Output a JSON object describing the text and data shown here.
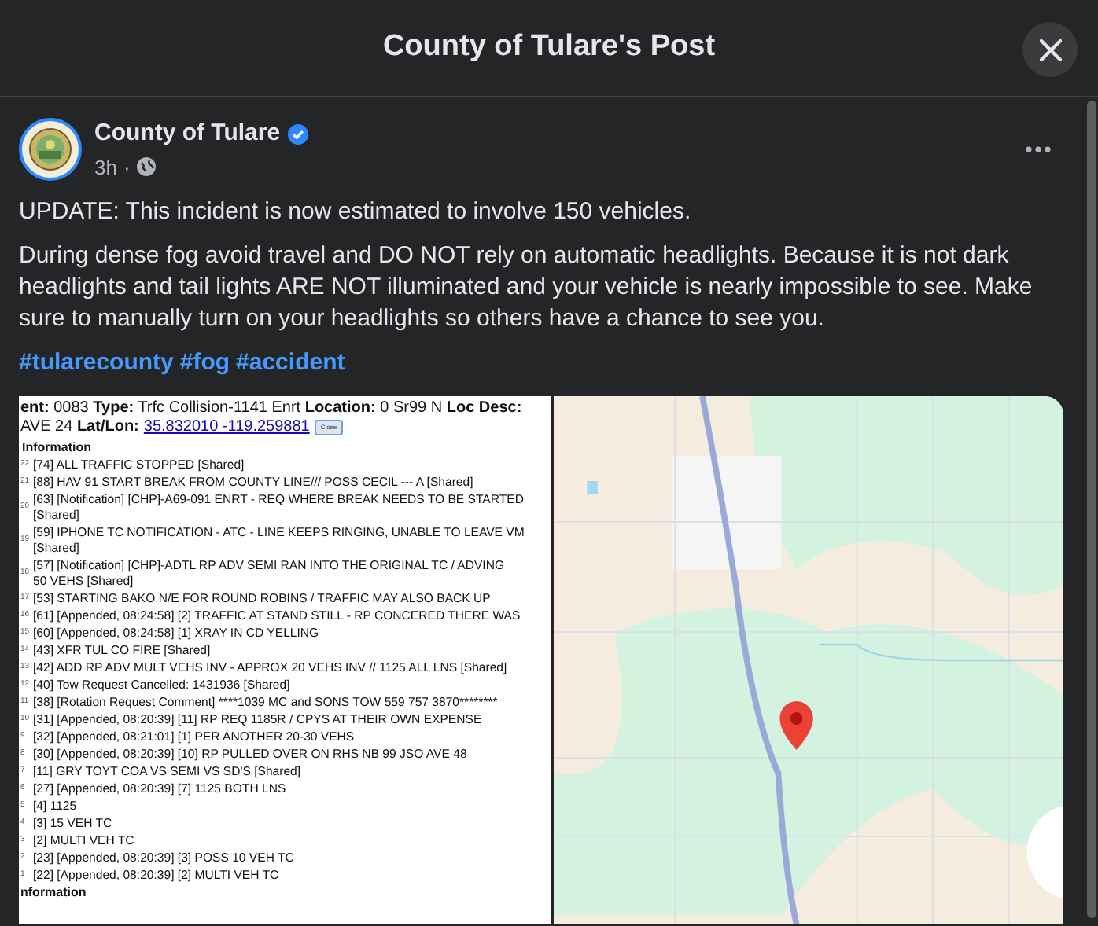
{
  "dialog": {
    "title": "County of Tulare's Post"
  },
  "post": {
    "author": "County of Tulare",
    "time": "3h",
    "separator": "·",
    "paragraphs": [
      "UPDATE: This incident is now estimated to involve 150 vehicles.",
      "During dense fog avoid travel and DO NOT rely on automatic headlights. Because it is not dark headlights and tail lights ARE NOT illuminated and your vehicle is nearly impossible to see. Make sure to manually turn on your headlights so others have a chance to see you."
    ],
    "hashtags": [
      "#tularecounty",
      "#fog",
      "#accident"
    ],
    "document": {
      "line_1": "**ent:** 0083 **Type:** Trfc Collision-1141 Enrt **Location:** 0 Sr99 N **Loc Desc:**",
      "line_2": "AVE 24 **Lat/Lon:**",
      "coordinates": "35.832010 -119.259881",
      "close_button": "Close",
      "section": "Information",
      "entries": [
        {
          "number": "22",
          "lines": [
            "[74] ALL TRAFFIC STOPPED [Shared]"
          ]
        },
        {
          "number": "21",
          "lines": [
            "[88] HAV 91 START BREAK FROM COUNTY LINE/// POSS CECIL --- A [Shared]"
          ]
        },
        {
          "number": "20",
          "lines": [
            "[63] [Notification] [CHP]-A69-091 ENRT - REQ WHERE BREAK NEEDS TO BE STARTED",
            "[Shared]"
          ]
        },
        {
          "number": "19",
          "lines": [
            "[59] IPHONE TC NOTIFICATION - ATC - LINE KEEPS RINGING, UNABLE TO LEAVE VM",
            "[Shared]"
          ]
        },
        {
          "number": "18",
          "lines": [
            "[57] [Notification] [CHP]-ADTL RP ADV SEMI RAN INTO THE ORIGINAL TC / ADVING",
            "50 VEHS [Shared]"
          ]
        },
        {
          "number": "17",
          "lines": [
            "[53] STARTING BAKO N/E FOR ROUND ROBINS / TRAFFIC MAY ALSO BACK UP"
          ]
        },
        {
          "number": "16",
          "lines": [
            "[61] [Appended, 08:24:58] [2] TRAFFIC AT STAND STILL - RP CONCERED THERE WAS"
          ]
        },
        {
          "number": "15",
          "lines": [
            "[60] [Appended, 08:24:58] [1] XRAY IN CD YELLING"
          ]
        },
        {
          "number": "14",
          "lines": [
            "[43] XFR TUL CO FIRE [Shared]"
          ]
        },
        {
          "number": "13",
          "lines": [
            "[42] ADD RP ADV MULT VEHS INV - APPROX 20 VEHS INV // 1125 ALL LNS [Shared]"
          ]
        },
        {
          "number": "12",
          "lines": [
            "[40] Tow Request Cancelled: 1431936 [Shared]"
          ]
        },
        {
          "number": "11",
          "lines": [
            "[38] [Rotation Request Comment] ****1039 MC and SONS TOW 559 757 3870********"
          ]
        },
        {
          "number": "10",
          "lines": [
            "[31] [Appended, 08:20:39] [11] RP REQ 1185R / CPYS AT THEIR OWN EXPENSE"
          ]
        },
        {
          "number": "9",
          "lines": [
            "[32] [Appended, 08:21:01] [1] PER ANOTHER 20-30 VEHS"
          ]
        },
        {
          "number": "8",
          "lines": [
            "[30] [Appended, 08:20:39] [10] RP PULLED OVER ON RHS NB 99 JSO AVE 48"
          ]
        },
        {
          "number": "7",
          "lines": [
            "[11] GRY TOYT COA VS SEMI VS SD'S [Shared]"
          ]
        },
        {
          "number": "6",
          "lines": [
            "[27] [Appended, 08:20:39] [7] 1125 BOTH LNS"
          ]
        },
        {
          "number": "5",
          "lines": [
            "[4] 1125"
          ]
        },
        {
          "number": "4",
          "lines": [
            "[3] 15 VEH TC"
          ]
        },
        {
          "number": "3",
          "lines": [
            "[2] MULTI VEH TC"
          ]
        },
        {
          "number": "2",
          "lines": [
            "[23] [Appended, 08:20:39] [3] POSS 10 VEH TC"
          ]
        },
        {
          "number": "1",
          "lines": [
            "[22] [Appended, 08:20:39] [2] MULTI VEH TC"
          ]
        }
      ],
      "footer": "nformation"
    },
    "map": {
      "kind": "picture"
    }
  }
}
